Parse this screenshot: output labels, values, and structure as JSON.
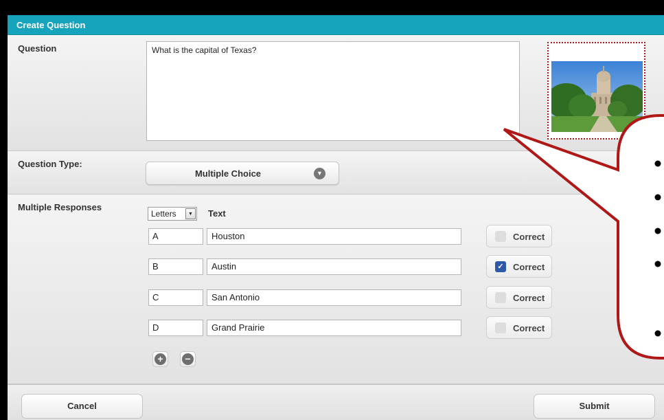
{
  "dialog": {
    "title": "Create Question"
  },
  "question": {
    "label": "Question",
    "text": "What is the capital of Texas?",
    "image_remove_icon": "close-circle-icon"
  },
  "question_type": {
    "label": "Question Type:",
    "value": "Multiple Choice",
    "chevron_icon": "chevron-down-icon"
  },
  "responses": {
    "label": "Multiple Responses",
    "numbering_select": "Letters",
    "text_header": "Text",
    "correct_label": "Correct",
    "items": [
      {
        "letter": "A",
        "text": "Houston",
        "correct": false
      },
      {
        "letter": "B",
        "text": "Austin",
        "correct": true
      },
      {
        "letter": "C",
        "text": "San Antonio",
        "correct": false
      },
      {
        "letter": "D",
        "text": "Grand Prairie",
        "correct": false
      }
    ],
    "add_icon": "plus-circle-icon",
    "remove_icon": "minus-circle-icon"
  },
  "footer": {
    "cancel_label": "Cancel",
    "submit_label": "Submit"
  },
  "callout": {
    "bullets": [
      "",
      "",
      "",
      "",
      ""
    ]
  },
  "colors": {
    "header": "#16a3bc",
    "callout_border": "#b01818",
    "checkbox_checked": "#2d5aa8"
  }
}
